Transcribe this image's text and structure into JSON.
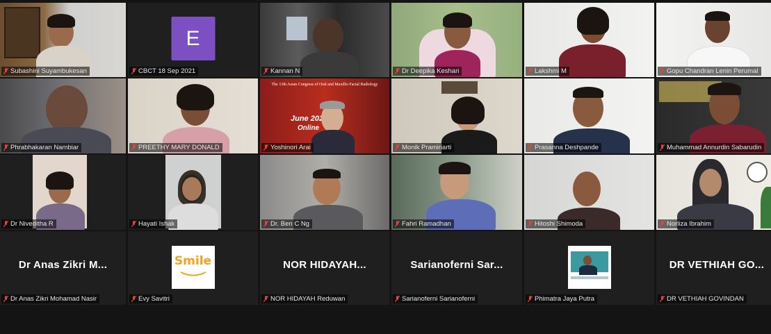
{
  "meeting": {
    "participants": [
      {
        "name": "Subashini Suyambukesan",
        "type": "video"
      },
      {
        "name": "CBCT 18 Sep 2021",
        "type": "avatar",
        "avatar_letter": "E"
      },
      {
        "name": "Kannan N",
        "type": "video"
      },
      {
        "name": "Dr Deepika Keshari",
        "type": "video"
      },
      {
        "name": "Lakshmi M",
        "type": "video"
      },
      {
        "name": "Gopu Chandran Lenin Perumal",
        "type": "video"
      },
      {
        "name": "Phrabhakaran Nambiar",
        "type": "video"
      },
      {
        "name": "PREETHY MARY DONALD",
        "type": "video"
      },
      {
        "name": "Yoshinori Arai",
        "type": "video",
        "poster": {
          "line1": "The 13th Asian Congress of Oral and Maxillo-Facial Radiology",
          "date": "June 2022",
          "mode": "Online"
        }
      },
      {
        "name": "Monik Pramiriarti",
        "type": "video"
      },
      {
        "name": "Prasanna Deshpande",
        "type": "video",
        "active_speaker": true
      },
      {
        "name": "Muhammad Annurdin Sabarudin",
        "type": "video"
      },
      {
        "name": "Dr Niveditha R",
        "type": "video"
      },
      {
        "name": "Hayati Ishak",
        "type": "video"
      },
      {
        "name": "Dr. Ben C Ng",
        "type": "video"
      },
      {
        "name": "Fahri Ramadhan",
        "type": "video"
      },
      {
        "name": "Hitoshi Shimoda",
        "type": "video"
      },
      {
        "name": "Norliza Ibrahim",
        "type": "video"
      },
      {
        "name": "Dr Anas Zikri Mohamad Nasir",
        "type": "name-only",
        "display": "Dr Anas Zikri M..."
      },
      {
        "name": "Evy Savitri",
        "type": "logo",
        "logo_text": "Smile"
      },
      {
        "name": "NOR HIDAYAH Reduwan",
        "type": "name-only",
        "display": "NOR HIDAYAH..."
      },
      {
        "name": "Sarianoferni Sarianoferni",
        "type": "name-only",
        "display": "Sarianoferni Sar..."
      },
      {
        "name": "Phimatra Jaya Putra",
        "type": "picture"
      },
      {
        "name": "DR VETHIAH GOVINDAN",
        "type": "name-only",
        "display": "DR VETHIAH GO..."
      }
    ]
  },
  "colors": {
    "background": "#141414",
    "tile": "#1f1f1f",
    "active_speaker_border": "#c8e04a",
    "muted_mic": "#e0453c",
    "avatar_bg": "#7c4fc3",
    "smile_logo": "#f2a31b"
  },
  "icons": {
    "muted": "muted-mic-icon"
  }
}
